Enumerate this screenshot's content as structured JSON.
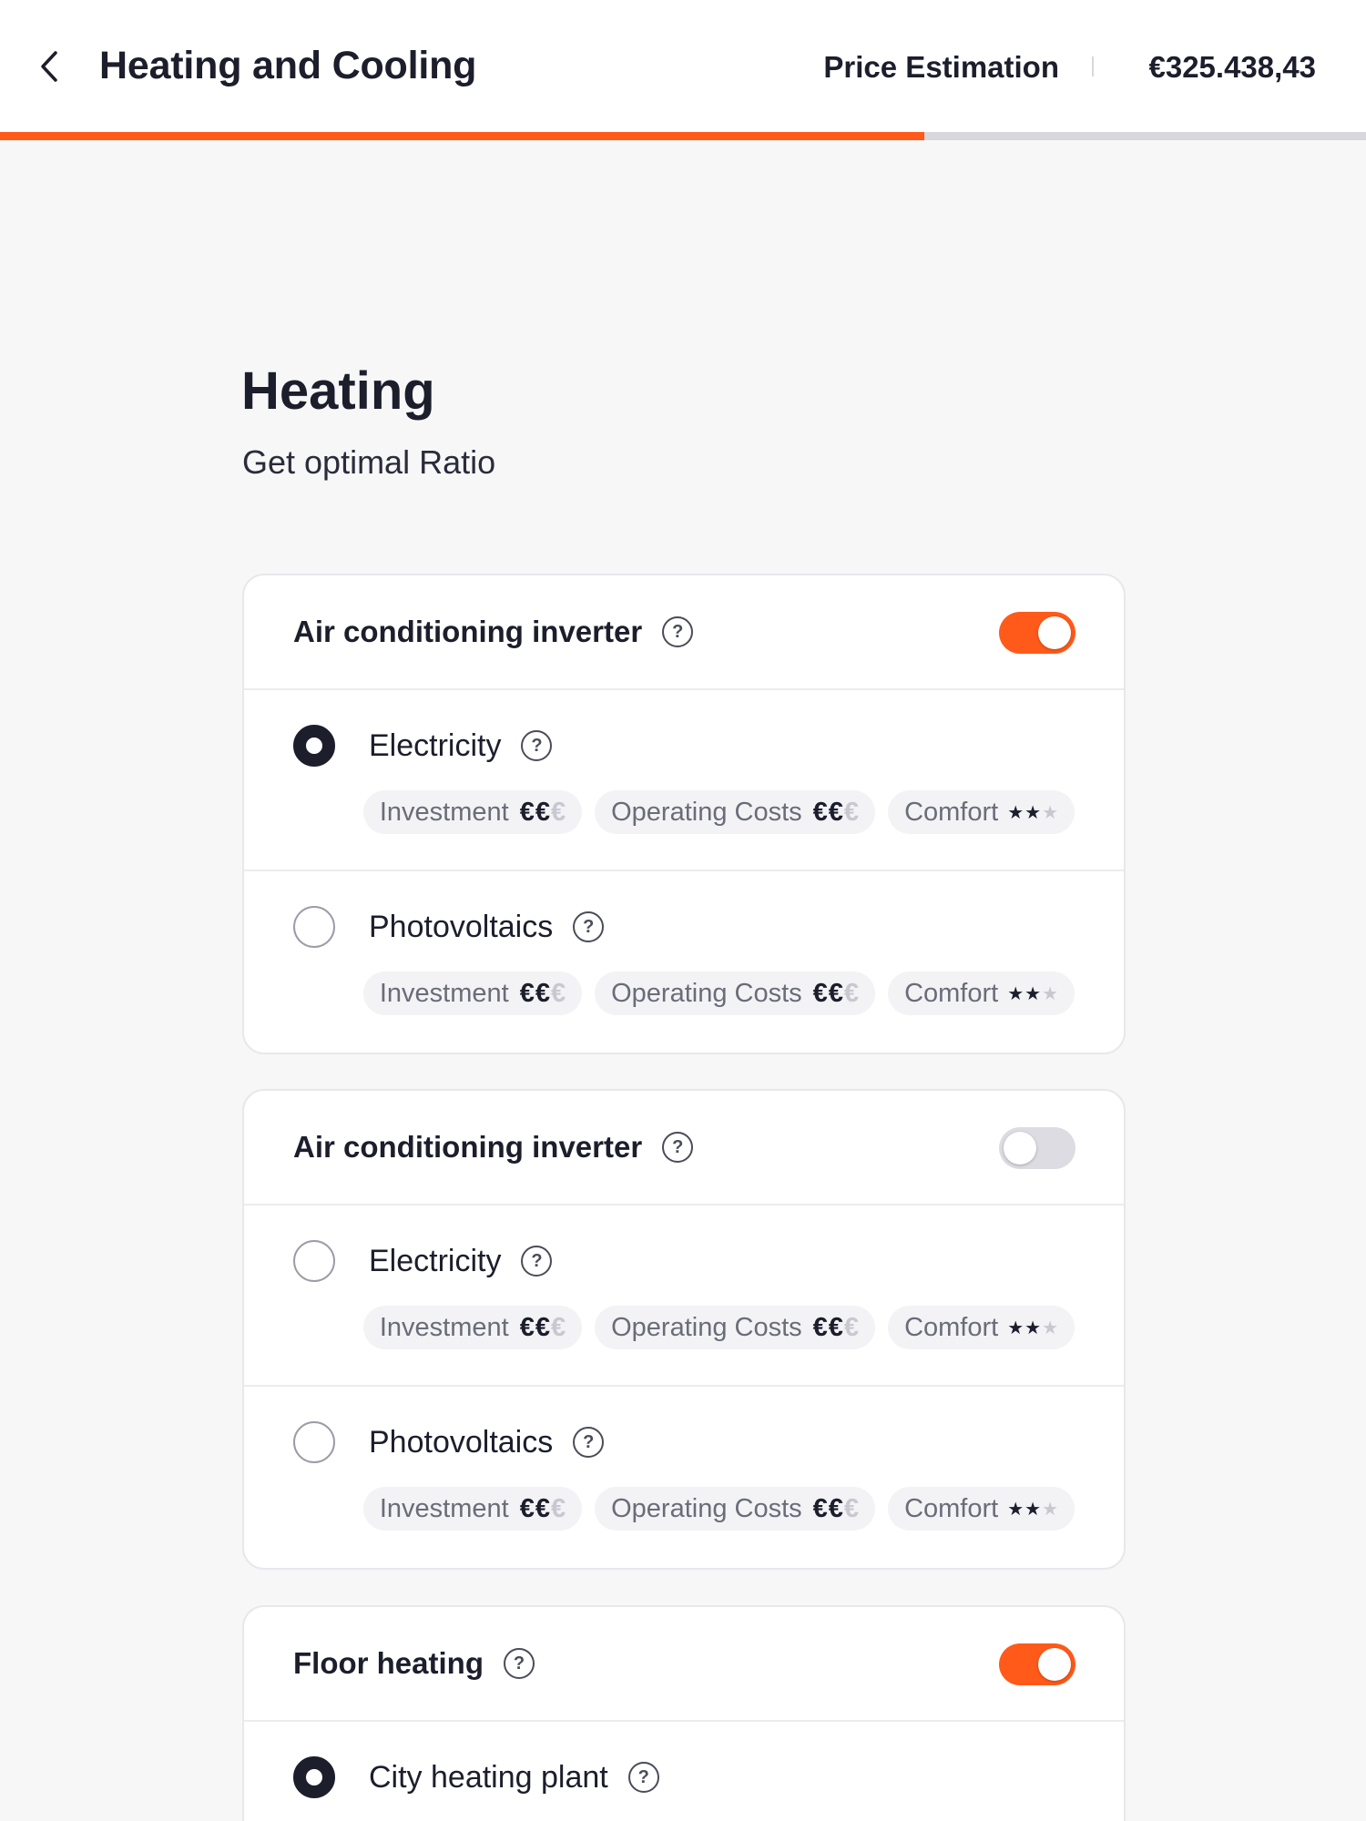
{
  "header": {
    "title": "Heating and Cooling",
    "price_label": "Price Estimation",
    "price_value": "€325.438,43",
    "progress": 0.677
  },
  "colors": {
    "accent": "#ff5a1a",
    "text": "#1c1e2c",
    "track": "#d7d7dc"
  },
  "section": {
    "title": "Heating",
    "subtitle": "Get optimal Ratio"
  },
  "cards": [
    {
      "title": "Air conditioning inverter",
      "toggle_on": true,
      "options": [
        {
          "label": "Electricity",
          "selected": true,
          "tags": {
            "investment": "Investment",
            "investment_value": "€€",
            "investment_rest": "€",
            "operating": "Operating Costs",
            "operating_value": "€€",
            "operating_rest": "€",
            "comfort": "Comfort",
            "comfort_value": "★★",
            "comfort_rest": "★"
          }
        },
        {
          "label": "Photovoltaics",
          "selected": false,
          "tags": {
            "investment": "Investment",
            "investment_value": "€€",
            "investment_rest": "€",
            "operating": "Operating Costs",
            "operating_value": "€€",
            "operating_rest": "€",
            "comfort": "Comfort",
            "comfort_value": "★★",
            "comfort_rest": "★"
          }
        }
      ]
    },
    {
      "title": "Air conditioning inverter",
      "toggle_on": false,
      "options": [
        {
          "label": "Electricity",
          "selected": false,
          "tags": {
            "investment": "Investment",
            "investment_value": "€€",
            "investment_rest": "€",
            "operating": "Operating Costs",
            "operating_value": "€€",
            "operating_rest": "€",
            "comfort": "Comfort",
            "comfort_value": "★★",
            "comfort_rest": "★"
          }
        },
        {
          "label": "Photovoltaics",
          "selected": false,
          "tags": {
            "investment": "Investment",
            "investment_value": "€€",
            "investment_rest": "€",
            "operating": "Operating Costs",
            "operating_value": "€€",
            "operating_rest": "€",
            "comfort": "Comfort",
            "comfort_value": "★★",
            "comfort_rest": "★"
          }
        }
      ]
    },
    {
      "title": "Floor heating",
      "toggle_on": true,
      "options": [
        {
          "label": "City heating plant",
          "selected": true
        }
      ]
    }
  ],
  "icons": {
    "back": "chevron-left-icon",
    "help": "question-circle-icon",
    "help_glyph": "?"
  }
}
